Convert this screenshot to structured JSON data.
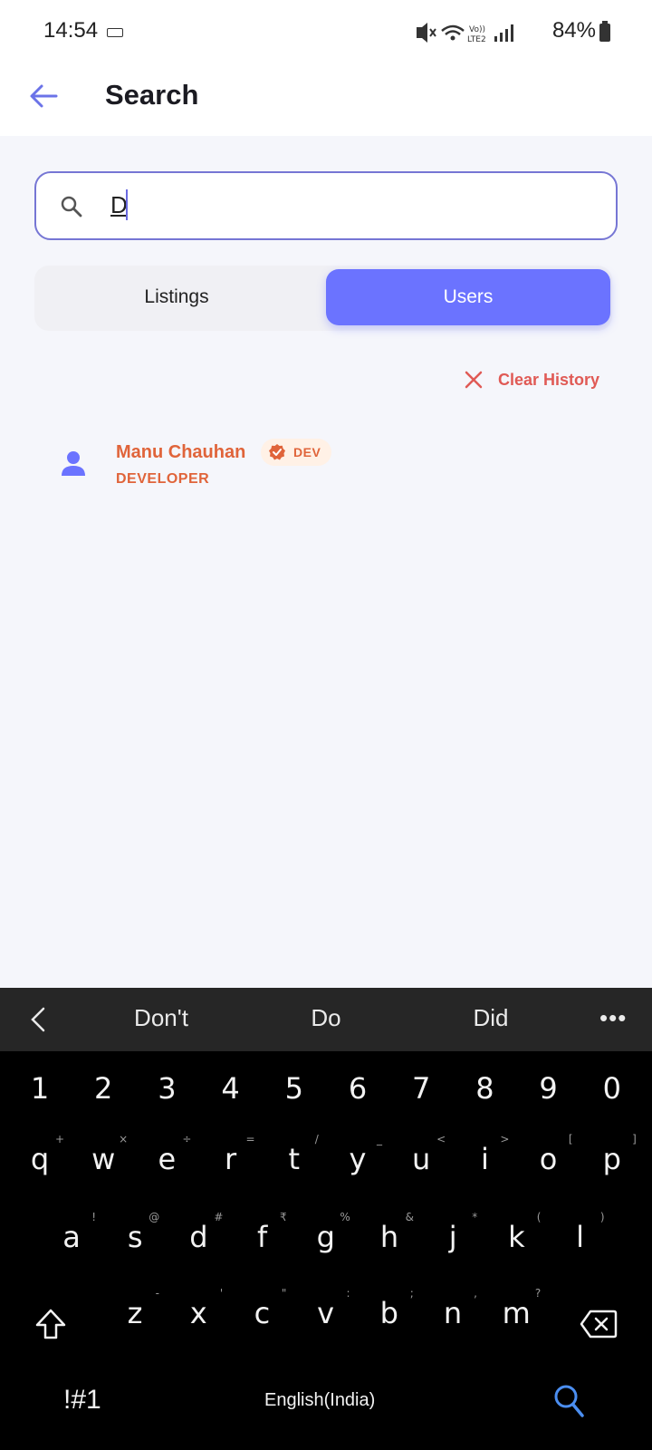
{
  "status": {
    "time": "14:54",
    "battery": "84%"
  },
  "header": {
    "title": "Search"
  },
  "search": {
    "value": "D"
  },
  "tabs": [
    {
      "label": "Listings",
      "active": false
    },
    {
      "label": "Users",
      "active": true
    }
  ],
  "clear_history": {
    "label": "Clear History"
  },
  "results": [
    {
      "name": "Manu Chauhan",
      "badge": "DEV",
      "role": "DEVELOPER"
    }
  ],
  "keyboard": {
    "suggestions": [
      "Don't",
      "Do",
      "Did"
    ],
    "row_numbers": [
      "1",
      "2",
      "3",
      "4",
      "5",
      "6",
      "7",
      "8",
      "9",
      "0"
    ],
    "row1": [
      {
        "k": "q",
        "h": "+"
      },
      {
        "k": "w",
        "h": "×"
      },
      {
        "k": "e",
        "h": "÷"
      },
      {
        "k": "r",
        "h": "="
      },
      {
        "k": "t",
        "h": "/"
      },
      {
        "k": "y",
        "h": "_"
      },
      {
        "k": "u",
        "h": "<"
      },
      {
        "k": "i",
        "h": ">"
      },
      {
        "k": "o",
        "h": "["
      },
      {
        "k": "p",
        "h": "]"
      }
    ],
    "row2": [
      {
        "k": "a",
        "h": "!"
      },
      {
        "k": "s",
        "h": "@"
      },
      {
        "k": "d",
        "h": "#"
      },
      {
        "k": "f",
        "h": "₹"
      },
      {
        "k": "g",
        "h": "%"
      },
      {
        "k": "h",
        "h": "&"
      },
      {
        "k": "j",
        "h": "*"
      },
      {
        "k": "k",
        "h": "("
      },
      {
        "k": "l",
        "h": ")"
      }
    ],
    "row3": [
      {
        "k": "z",
        "h": "-"
      },
      {
        "k": "x",
        "h": "'"
      },
      {
        "k": "c",
        "h": "\""
      },
      {
        "k": "v",
        "h": ":"
      },
      {
        "k": "b",
        "h": ";"
      },
      {
        "k": "n",
        "h": ","
      },
      {
        "k": "m",
        "h": "?"
      }
    ],
    "symbols_label": "!#1",
    "language_label": "English(India)"
  },
  "colors": {
    "accent": "#6b73ff",
    "result_text": "#e0643a",
    "clear_text": "#e05a55",
    "background": "#f5f6fb"
  }
}
